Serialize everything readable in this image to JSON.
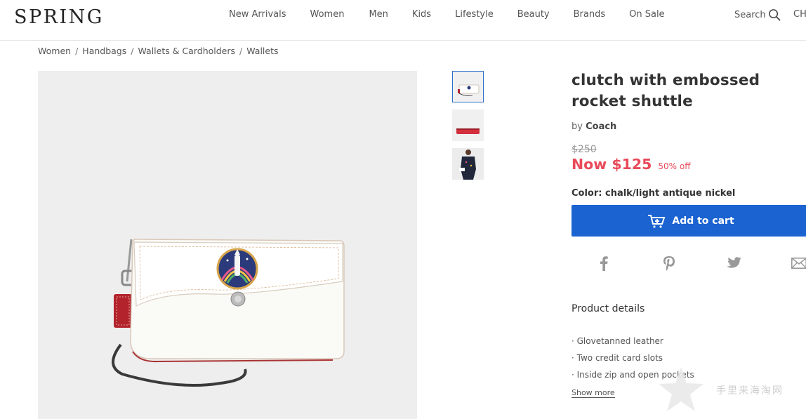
{
  "header": {
    "logo": "SPRING",
    "nav": [
      "New Arrivals",
      "Women",
      "Men",
      "Kids",
      "Lifestyle",
      "Beauty",
      "Brands",
      "On Sale"
    ],
    "search_label": "Search",
    "lang": "CH"
  },
  "breadcrumb": [
    "Women",
    "Handbags",
    "Wallets & Cardholders",
    "Wallets"
  ],
  "breadcrumb_sep": "/",
  "product": {
    "title": "clutch with embossed rocket shuttle",
    "by": "by",
    "brand": "Coach",
    "old_price": "$250",
    "now_price": "Now $125",
    "discount": "50% off",
    "color": "Color: chalk/light antique nickel",
    "add_to_cart": "Add to cart",
    "details_title": "Product details",
    "details": [
      "· Glovetanned leather",
      "· Two credit card slots",
      "· Inside zip and open pockets"
    ],
    "show_more": "Show more"
  },
  "watermark": "手里来海淘网",
  "colors": {
    "accent": "#1a63d1",
    "sale": "#e84a5a"
  }
}
